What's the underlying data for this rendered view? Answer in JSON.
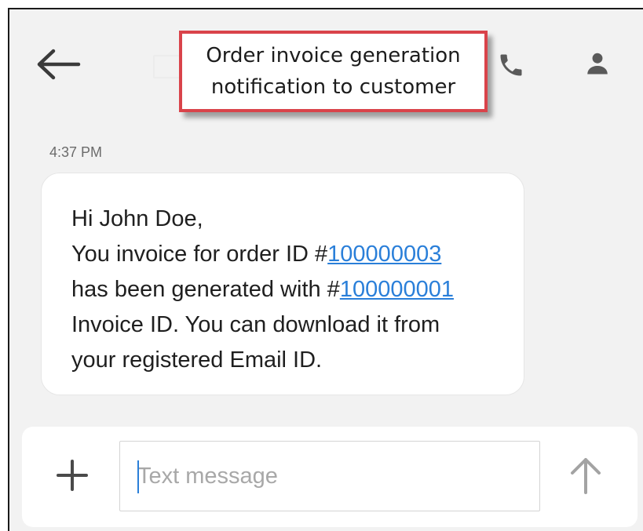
{
  "callout": {
    "line1": "Order invoice generation",
    "line2": "notification to customer"
  },
  "header": {
    "back_icon": "arrow-left-icon",
    "call_icon": "phone-icon",
    "contact_icon": "person-icon"
  },
  "message": {
    "timestamp": "4:37 PM",
    "greeting": "Hi John Doe,",
    "line2_prefix": "You invoice for order ID #",
    "order_id": "100000003",
    "line3_prefix": "has been generated with #",
    "invoice_id": "100000001",
    "line4": "Invoice ID. You can download it from",
    "line5": "your registered Email ID."
  },
  "composer": {
    "placeholder": "Text message",
    "value": "",
    "add_icon": "plus-icon",
    "send_icon": "arrow-up-icon"
  },
  "colors": {
    "link": "#2a7fd9",
    "callout_border": "#d9434a",
    "background": "#f2f2f2"
  }
}
